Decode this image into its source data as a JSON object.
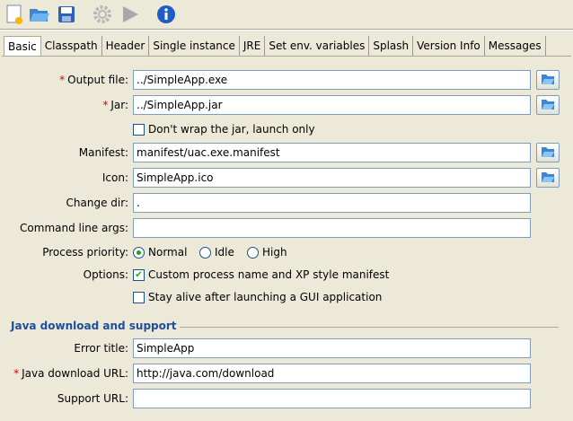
{
  "toolbar": {
    "buttons": [
      "new-icon",
      "open-icon",
      "save-icon",
      "build-icon",
      "run-icon",
      "info-icon"
    ]
  },
  "tabs": [
    "Basic",
    "Classpath",
    "Header",
    "Single instance",
    "JRE",
    "Set env. variables",
    "Splash",
    "Version Info",
    "Messages"
  ],
  "form": {
    "output_file": {
      "label": "Output file:",
      "value": "../SimpleApp.exe",
      "required": true
    },
    "jar": {
      "label": "Jar:",
      "value": "../SimpleApp.jar",
      "required": true
    },
    "dont_wrap": {
      "label": "Don't wrap the jar, launch only",
      "checked": false
    },
    "manifest": {
      "label": "Manifest:",
      "value": "manifest/uac.exe.manifest"
    },
    "icon": {
      "label": "Icon:",
      "value": "SimpleApp.ico"
    },
    "change_dir": {
      "label": "Change dir:",
      "value": "."
    },
    "cmd_args": {
      "label": "Command line args:",
      "value": ""
    },
    "priority": {
      "label": "Process priority:",
      "options": [
        "Normal",
        "Idle",
        "High"
      ],
      "selected": "Normal"
    },
    "options": {
      "label": "Options:",
      "custom_name": "Custom process name and XP style manifest",
      "custom_name_checked": true,
      "stay_alive": "Stay alive after launching a GUI application",
      "stay_alive_checked": false
    }
  },
  "java": {
    "section_title": "Java download and support",
    "error_title": {
      "label": "Error title:",
      "value": "SimpleApp"
    },
    "download_url": {
      "label": "Java download URL:",
      "value": "http://java.com/download",
      "required": true
    },
    "support_url": {
      "label": "Support URL:",
      "value": ""
    }
  },
  "required_mark": "*"
}
